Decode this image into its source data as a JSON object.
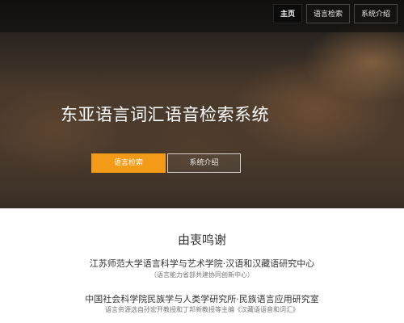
{
  "nav": {
    "items": [
      {
        "label": "主页",
        "active": true
      },
      {
        "label": "语言检索",
        "active": false
      },
      {
        "label": "系统介绍",
        "active": false
      }
    ]
  },
  "hero": {
    "title": "东亚语言词汇语音检索系统",
    "primary_button": "语言检索",
    "secondary_button": "系统介绍"
  },
  "ack": {
    "title": "由衷鸣谢",
    "orgs": [
      {
        "name": "江苏师范大学语言科学与艺术学院·汉语和汉藏语研究中心",
        "note": "（语言能力省部共建协同创新中心）"
      },
      {
        "name": "中国社会科学院民族学与人类学研究所·民族语言应用研究室",
        "note": "语言资源选自孙宏开教授和丁邦新教授等主编《汉藏语语音和词汇》"
      }
    ]
  },
  "colors": {
    "accent": "#f39a16",
    "topbar": "#0b0b0b"
  }
}
